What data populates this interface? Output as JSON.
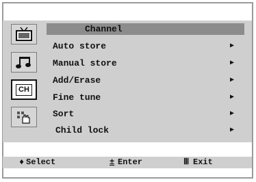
{
  "menu": {
    "title": "Channel",
    "items": [
      {
        "label": "Auto store",
        "arrow": "▶"
      },
      {
        "label": "Manual store",
        "arrow": "▶"
      },
      {
        "label": "Add/Erase",
        "arrow": "▶"
      },
      {
        "label": "Fine tune",
        "arrow": "▶"
      },
      {
        "label": "Sort",
        "arrow": "▶"
      },
      {
        "label": "Child lock",
        "arrow": "▶"
      }
    ]
  },
  "sidebar": {
    "icons": [
      {
        "name": "tv-picture-icon"
      },
      {
        "name": "sound-music-icon"
      },
      {
        "name": "channel-icon",
        "text": "CH",
        "selected": true
      },
      {
        "name": "setup-hand-icon"
      }
    ]
  },
  "help": {
    "select_symbol": "♦",
    "select_label": "Select",
    "enter_symbol": "±",
    "enter_label": "Enter",
    "exit_symbol": "Ⅲ",
    "exit_label": "Exit"
  },
  "colors": {
    "panel": "#cfcfcf",
    "title_bar": "#8c8c8c",
    "selected_icon_border": "#111111"
  }
}
